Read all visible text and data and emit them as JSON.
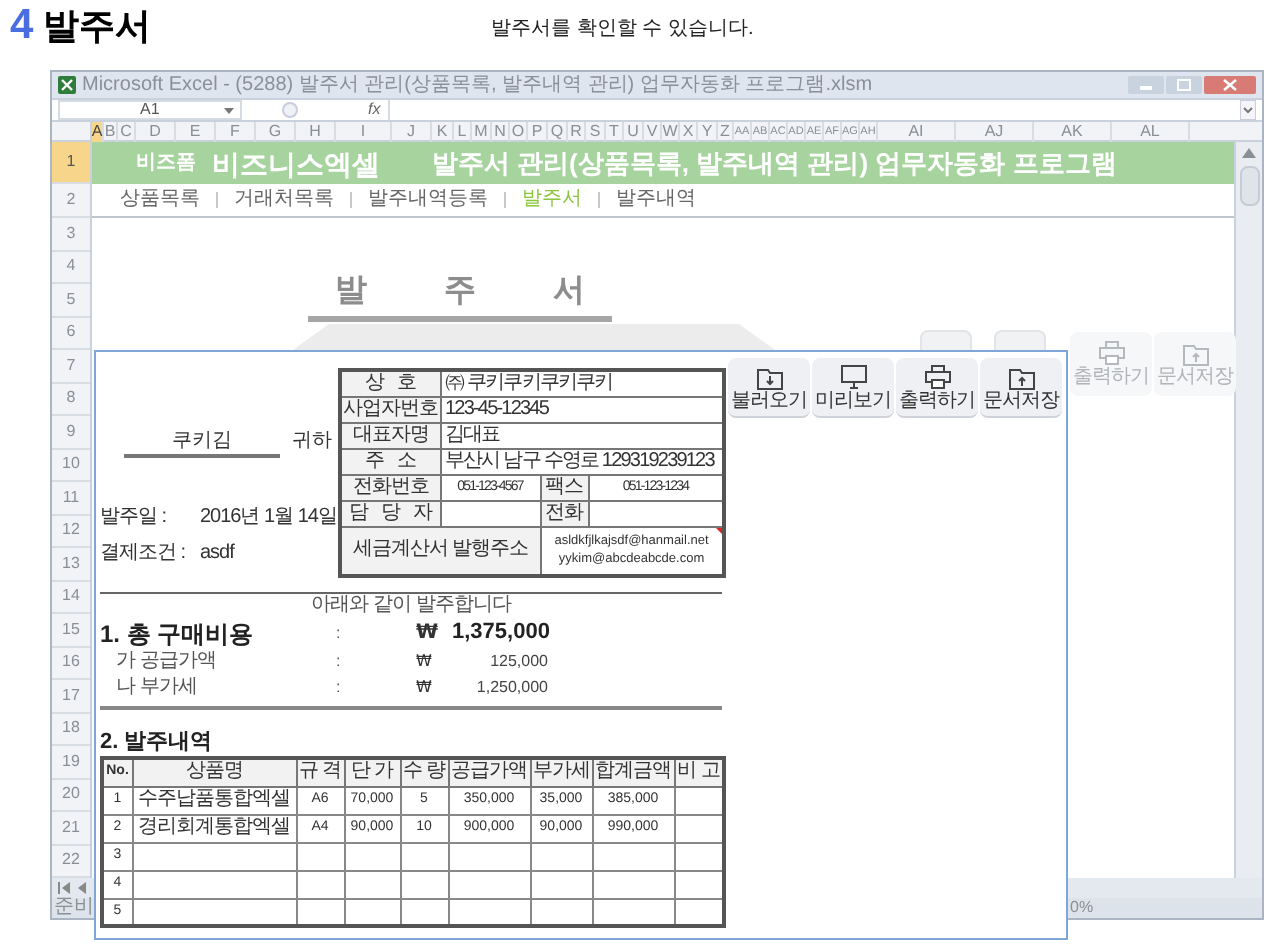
{
  "heading": {
    "number": "4",
    "title": "발주서"
  },
  "subtitle": "발주서를 확인할 수 있습니다.",
  "window": {
    "title": "Microsoft Excel - (5288) 발주서 관리(상품목록, 발주내역 관리) 업무자동화 프로그램.xlsm"
  },
  "formula_bar": {
    "name_box": "A1",
    "function_label": "fx"
  },
  "columns": [
    {
      "label": "A",
      "selected": true
    },
    {
      "label": "B",
      "selected": false
    },
    {
      "label": "C",
      "selected": false
    },
    {
      "label": "D",
      "selected": false
    },
    {
      "label": "E",
      "selected": false
    },
    {
      "label": "F",
      "selected": false
    },
    {
      "label": "G",
      "selected": false
    },
    {
      "label": "H",
      "selected": false
    },
    {
      "label": "I",
      "selected": false
    },
    {
      "label": "J",
      "selected": false
    },
    {
      "label": "K",
      "selected": false
    },
    {
      "label": "L",
      "selected": false
    },
    {
      "label": "M",
      "selected": false
    },
    {
      "label": "N",
      "selected": false
    },
    {
      "label": "O",
      "selected": false
    },
    {
      "label": "P",
      "selected": false
    },
    {
      "label": "Q",
      "selected": false
    },
    {
      "label": "R",
      "selected": false
    },
    {
      "label": "S",
      "selected": false
    },
    {
      "label": "T",
      "selected": false
    },
    {
      "label": "U",
      "selected": false
    },
    {
      "label": "V",
      "selected": false
    },
    {
      "label": "W",
      "selected": false
    },
    {
      "label": "X",
      "selected": false
    },
    {
      "label": "Y",
      "selected": false
    },
    {
      "label": "Z",
      "selected": false
    },
    {
      "label": "AA",
      "selected": false
    },
    {
      "label": "AB",
      "selected": false
    },
    {
      "label": "AC",
      "selected": false
    },
    {
      "label": "AD",
      "selected": false
    },
    {
      "label": "AE",
      "selected": false
    },
    {
      "label": "AF",
      "selected": false
    },
    {
      "label": "AG",
      "selected": false
    },
    {
      "label": "AH",
      "selected": false
    },
    {
      "label": "AI",
      "selected": false
    },
    {
      "label": "AJ",
      "selected": false
    },
    {
      "label": "AK",
      "selected": false
    },
    {
      "label": "AL",
      "selected": false
    }
  ],
  "rows": [
    {
      "label": "1",
      "selected": true
    },
    {
      "label": "2",
      "selected": false
    },
    {
      "label": "3",
      "selected": false
    },
    {
      "label": "4",
      "selected": false
    },
    {
      "label": "5",
      "selected": false
    },
    {
      "label": "6",
      "selected": false
    },
    {
      "label": "7",
      "selected": false
    },
    {
      "label": "8",
      "selected": false
    },
    {
      "label": "9",
      "selected": false
    },
    {
      "label": "10",
      "selected": false
    },
    {
      "label": "11",
      "selected": false
    },
    {
      "label": "12",
      "selected": false
    },
    {
      "label": "13",
      "selected": false
    },
    {
      "label": "14",
      "selected": false
    },
    {
      "label": "15",
      "selected": false
    },
    {
      "label": "16",
      "selected": false
    },
    {
      "label": "17",
      "selected": false
    },
    {
      "label": "18",
      "selected": false
    },
    {
      "label": "19",
      "selected": false
    },
    {
      "label": "20",
      "selected": false
    },
    {
      "label": "21",
      "selected": false
    },
    {
      "label": "22",
      "selected": false
    }
  ],
  "banner": {
    "tag": "비즈폼",
    "brand": "비즈니스엑셀",
    "title": "발주서 관리(상품목록, 발주내역 관리) 업무자동화 프로그램"
  },
  "nav": [
    {
      "label": "상품목록",
      "selected": false
    },
    {
      "label": "거래처목록",
      "selected": false
    },
    {
      "label": "발주내역등록",
      "selected": false
    },
    {
      "label": "발주서",
      "selected": true
    },
    {
      "label": "발주내역",
      "selected": false
    }
  ],
  "sheet": {
    "title": "발 주 서",
    "buttons": [
      {
        "label": "출력하기"
      },
      {
        "label": "문서저장"
      }
    ]
  },
  "status_bar": {
    "mode": "준비",
    "zoom": "0%"
  },
  "order_form": {
    "recipient": "쿠키김",
    "honorific": "귀하",
    "fields": [
      {
        "label": "발주일 :",
        "value": "2016년 1월 14일"
      },
      {
        "label": "결제조건 :",
        "value": "asdf"
      }
    ],
    "supplier": [
      {
        "kind": "single",
        "label": "상 호",
        "value": "㈜ 쿠키쿠키쿠키쿠키"
      },
      {
        "kind": "single",
        "label": "사업자번호",
        "value": "123-45-12345"
      },
      {
        "kind": "single",
        "label": "대표자명",
        "value": "김대표"
      },
      {
        "kind": "single",
        "label": "주 소",
        "value": "부산시 남구 수영로 129319239123"
      },
      {
        "kind": "pair",
        "label": "전화번호",
        "value": "051-123-4567",
        "label2": "팩스",
        "value2": "051-123-1234"
      },
      {
        "kind": "pair",
        "label": "담 당 자",
        "label2": "전화"
      },
      {
        "kind": "email",
        "label": "세금계산서 발행주소",
        "values": [
          "asldkfjlkajsdf@hanmail.net",
          "yykim@abcdeabcde.com"
        ]
      }
    ],
    "buttons": [
      {
        "label": "불러오기"
      },
      {
        "label": "미리보기"
      },
      {
        "label": "출력하기"
      },
      {
        "label": "문서저장"
      }
    ],
    "notice": "아래와 같이 발주합니다",
    "total": {
      "label": "1. 총 구매비용",
      "colon": ":",
      "currency": "₩",
      "amount": "1,375,000"
    },
    "breakdown": [
      {
        "label": "가 공급가액",
        "colon": ":",
        "currency": "₩",
        "amount": "125,000"
      },
      {
        "label": "나 부가세",
        "colon": ":",
        "currency": "₩",
        "amount": "1,250,000"
      }
    ],
    "items_heading": "2. 발주내역",
    "items_table": {
      "columns": [
        "No.",
        "상품명",
        "규 격",
        "단 가",
        "수 량",
        "공급가액",
        "부가세",
        "합계금액",
        "비 고"
      ],
      "rows": [
        [
          "1",
          "수주납품통합엑셀",
          "A6",
          "70,000",
          "5",
          "350,000",
          "35,000",
          "385,000"
        ],
        [
          "2",
          "경리회계통합엑셀",
          "A4",
          "90,000",
          "10",
          "900,000",
          "90,000",
          "990,000"
        ],
        [
          "3"
        ],
        [
          "4"
        ],
        [
          "5"
        ]
      ]
    }
  }
}
